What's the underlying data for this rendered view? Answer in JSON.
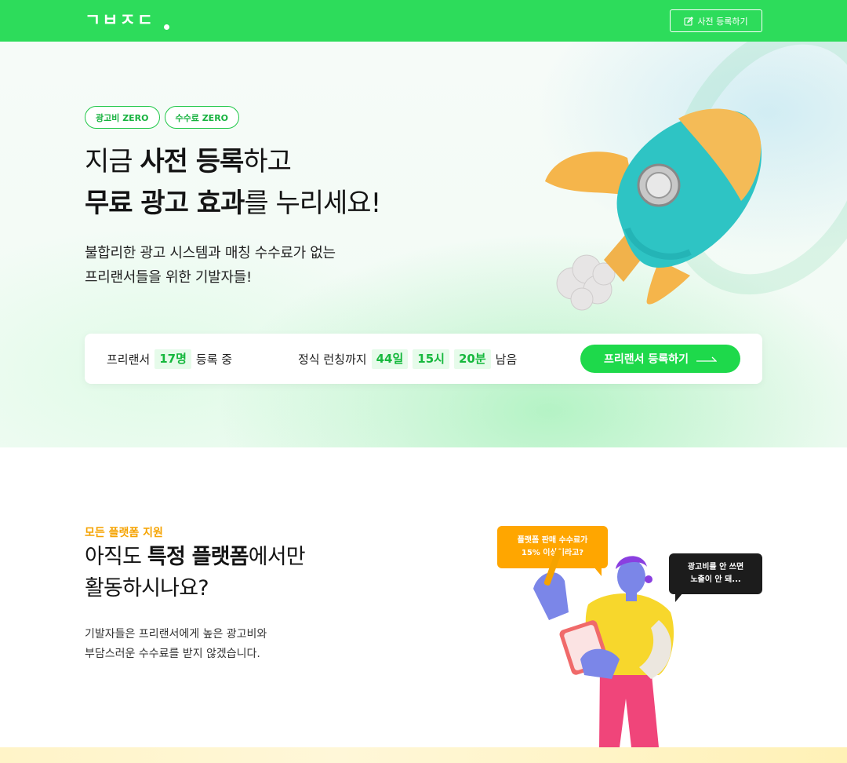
{
  "header": {
    "logo_text": "ㄱㅂㅈㄷ",
    "pre_register_label": "사전 등록하기",
    "accent_color": "#2ddc5b"
  },
  "hero": {
    "badges": [
      "광고비 ZERO",
      "수수료 ZERO"
    ],
    "title_line1": {
      "pre": "지금 ",
      "bold": "사전 등록",
      "post": "하고"
    },
    "title_line2": {
      "bold": "무료 광고 효과",
      "post": "를 누리세요!"
    },
    "subtitle_line1": "불합리한 광고 시스템과 매칭 수수료가 없는",
    "subtitle_line2": "프리랜서들을 위한 기발자들!"
  },
  "stats": {
    "freelancer_prefix": "프리랜서",
    "freelancer_count": "17명",
    "freelancer_suffix": "등록 중",
    "launch_prefix": "정식 런칭까지",
    "days": "44일",
    "hours": "15시",
    "minutes": "20분",
    "launch_suffix": "남음",
    "register_label": "프리랜서 등록하기"
  },
  "section2": {
    "eyebrow": "모든 플랫폼 지원",
    "title_line1": {
      "pre": "아직도 ",
      "bold": "특정 플랫폼",
      "post": "에서만"
    },
    "title_line2": "활동하시나요?",
    "sub_line1": "기발자들은 프리랜서에게 높은 광고비와",
    "sub_line2": "부담스러운 수수료를 받지 않겠습니다.",
    "bubble_yellow_line1": "플랫폼 판매 수수료가",
    "bubble_yellow_line2": "15% 이상이라고?",
    "bubble_black_line1": "광고비를 안 쓰면",
    "bubble_black_line2": "노출이 안 돼..."
  }
}
